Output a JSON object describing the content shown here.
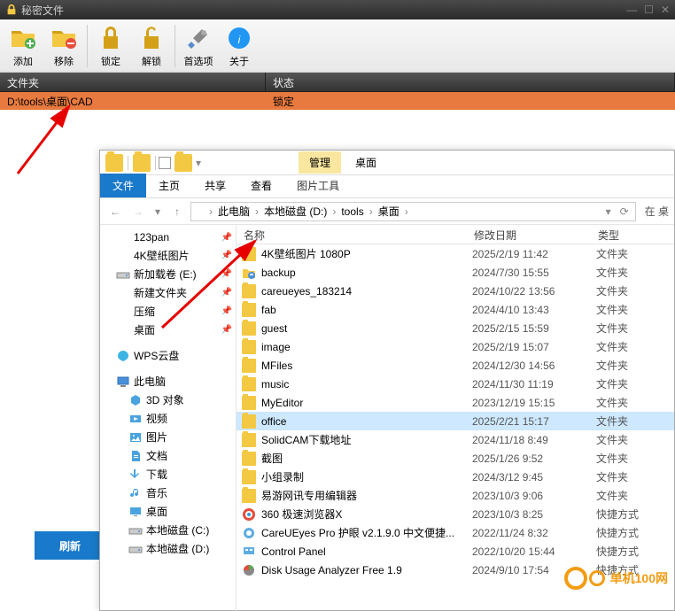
{
  "app": {
    "title": "秘密文件",
    "toolbar": {
      "add": "添加",
      "remove": "移除",
      "lock": "锁定",
      "unlock": "解锁",
      "options": "首选项",
      "about": "关于"
    },
    "columns": {
      "folder": "文件夹",
      "status": "状态"
    },
    "rows": [
      {
        "path": "D:\\tools\\桌面\\CAD",
        "status": "锁定"
      }
    ],
    "refresh": "刷新"
  },
  "explorer": {
    "tabs": {
      "manage": "管理",
      "desktop": "桌面",
      "file": "文件",
      "home": "主页",
      "share": "共享",
      "view": "查看",
      "picTools": "图片工具"
    },
    "breadcrumbs": [
      "此电脑",
      "本地磁盘 (D:)",
      "tools",
      "桌面"
    ],
    "searchHint": "在 桌",
    "tree": [
      {
        "label": "123pan",
        "icon": "folder",
        "pinned": true
      },
      {
        "label": "4K壁纸图片",
        "icon": "folder",
        "pinned": true
      },
      {
        "label": "新加载卷 (E:)",
        "icon": "drive",
        "pinned": true
      },
      {
        "label": "新建文件夹",
        "icon": "folder",
        "pinned": true
      },
      {
        "label": "压缩",
        "icon": "folder",
        "pinned": true
      },
      {
        "label": "桌面",
        "icon": "folder",
        "pinned": true
      },
      {
        "label": "WPS云盘",
        "icon": "wps",
        "pinned": false,
        "spaceBefore": true
      },
      {
        "label": "此电脑",
        "icon": "pc",
        "pinned": false,
        "spaceBefore": true
      },
      {
        "label": "3D 对象",
        "icon": "3d",
        "pinned": false,
        "indent": true
      },
      {
        "label": "视频",
        "icon": "video",
        "pinned": false,
        "indent": true
      },
      {
        "label": "图片",
        "icon": "image",
        "pinned": false,
        "indent": true
      },
      {
        "label": "文档",
        "icon": "doc",
        "pinned": false,
        "indent": true
      },
      {
        "label": "下载",
        "icon": "download",
        "pinned": false,
        "indent": true
      },
      {
        "label": "音乐",
        "icon": "music",
        "pinned": false,
        "indent": true
      },
      {
        "label": "桌面",
        "icon": "desktop",
        "pinned": false,
        "indent": true
      },
      {
        "label": "本地磁盘 (C:)",
        "icon": "drive",
        "pinned": false,
        "indent": true
      },
      {
        "label": "本地磁盘 (D:)",
        "icon": "drive",
        "pinned": false,
        "indent": true
      }
    ],
    "fileColumns": {
      "name": "名称",
      "date": "修改日期",
      "type": "类型"
    },
    "files": [
      {
        "name": "4K壁纸图片 1080P",
        "date": "2025/2/19 11:42",
        "type": "文件夹",
        "icon": "folder"
      },
      {
        "name": "backup",
        "date": "2024/7/30 15:55",
        "type": "文件夹",
        "icon": "foldershare"
      },
      {
        "name": "careueyes_183214",
        "date": "2024/10/22 13:56",
        "type": "文件夹",
        "icon": "folder"
      },
      {
        "name": "fab",
        "date": "2024/4/10 13:43",
        "type": "文件夹",
        "icon": "folder"
      },
      {
        "name": "guest",
        "date": "2025/2/15 15:59",
        "type": "文件夹",
        "icon": "folder"
      },
      {
        "name": "image",
        "date": "2025/2/19 15:07",
        "type": "文件夹",
        "icon": "folder"
      },
      {
        "name": "MFiles",
        "date": "2024/12/30 14:56",
        "type": "文件夹",
        "icon": "folder"
      },
      {
        "name": "music",
        "date": "2024/11/30 11:19",
        "type": "文件夹",
        "icon": "folder"
      },
      {
        "name": "MyEditor",
        "date": "2023/12/19 15:15",
        "type": "文件夹",
        "icon": "folder"
      },
      {
        "name": "office",
        "date": "2025/2/21 15:17",
        "type": "文件夹",
        "icon": "folder",
        "selected": true
      },
      {
        "name": "SolidCAM下载地址",
        "date": "2024/11/18 8:49",
        "type": "文件夹",
        "icon": "folder"
      },
      {
        "name": "截图",
        "date": "2025/1/26 9:52",
        "type": "文件夹",
        "icon": "folder"
      },
      {
        "name": "小组录制",
        "date": "2024/3/12 9:45",
        "type": "文件夹",
        "icon": "folder"
      },
      {
        "name": "易游网讯专用编辑器",
        "date": "2023/10/3 9:06",
        "type": "文件夹",
        "icon": "folder"
      },
      {
        "name": "360 极速浏览器X",
        "date": "2023/10/3 8:25",
        "type": "快捷方式",
        "icon": "app1"
      },
      {
        "name": "CareUEyes Pro 护眼 v2.1.9.0 中文便捷...",
        "date": "2022/11/24 8:32",
        "type": "快捷方式",
        "icon": "app2"
      },
      {
        "name": "Control Panel",
        "date": "2022/10/20 15:44",
        "type": "快捷方式",
        "icon": "cpl"
      },
      {
        "name": "Disk Usage Analyzer Free 1.9",
        "date": "2024/9/10 17:54",
        "type": "快捷方式",
        "icon": "disk"
      }
    ]
  },
  "watermark": "单机100网"
}
